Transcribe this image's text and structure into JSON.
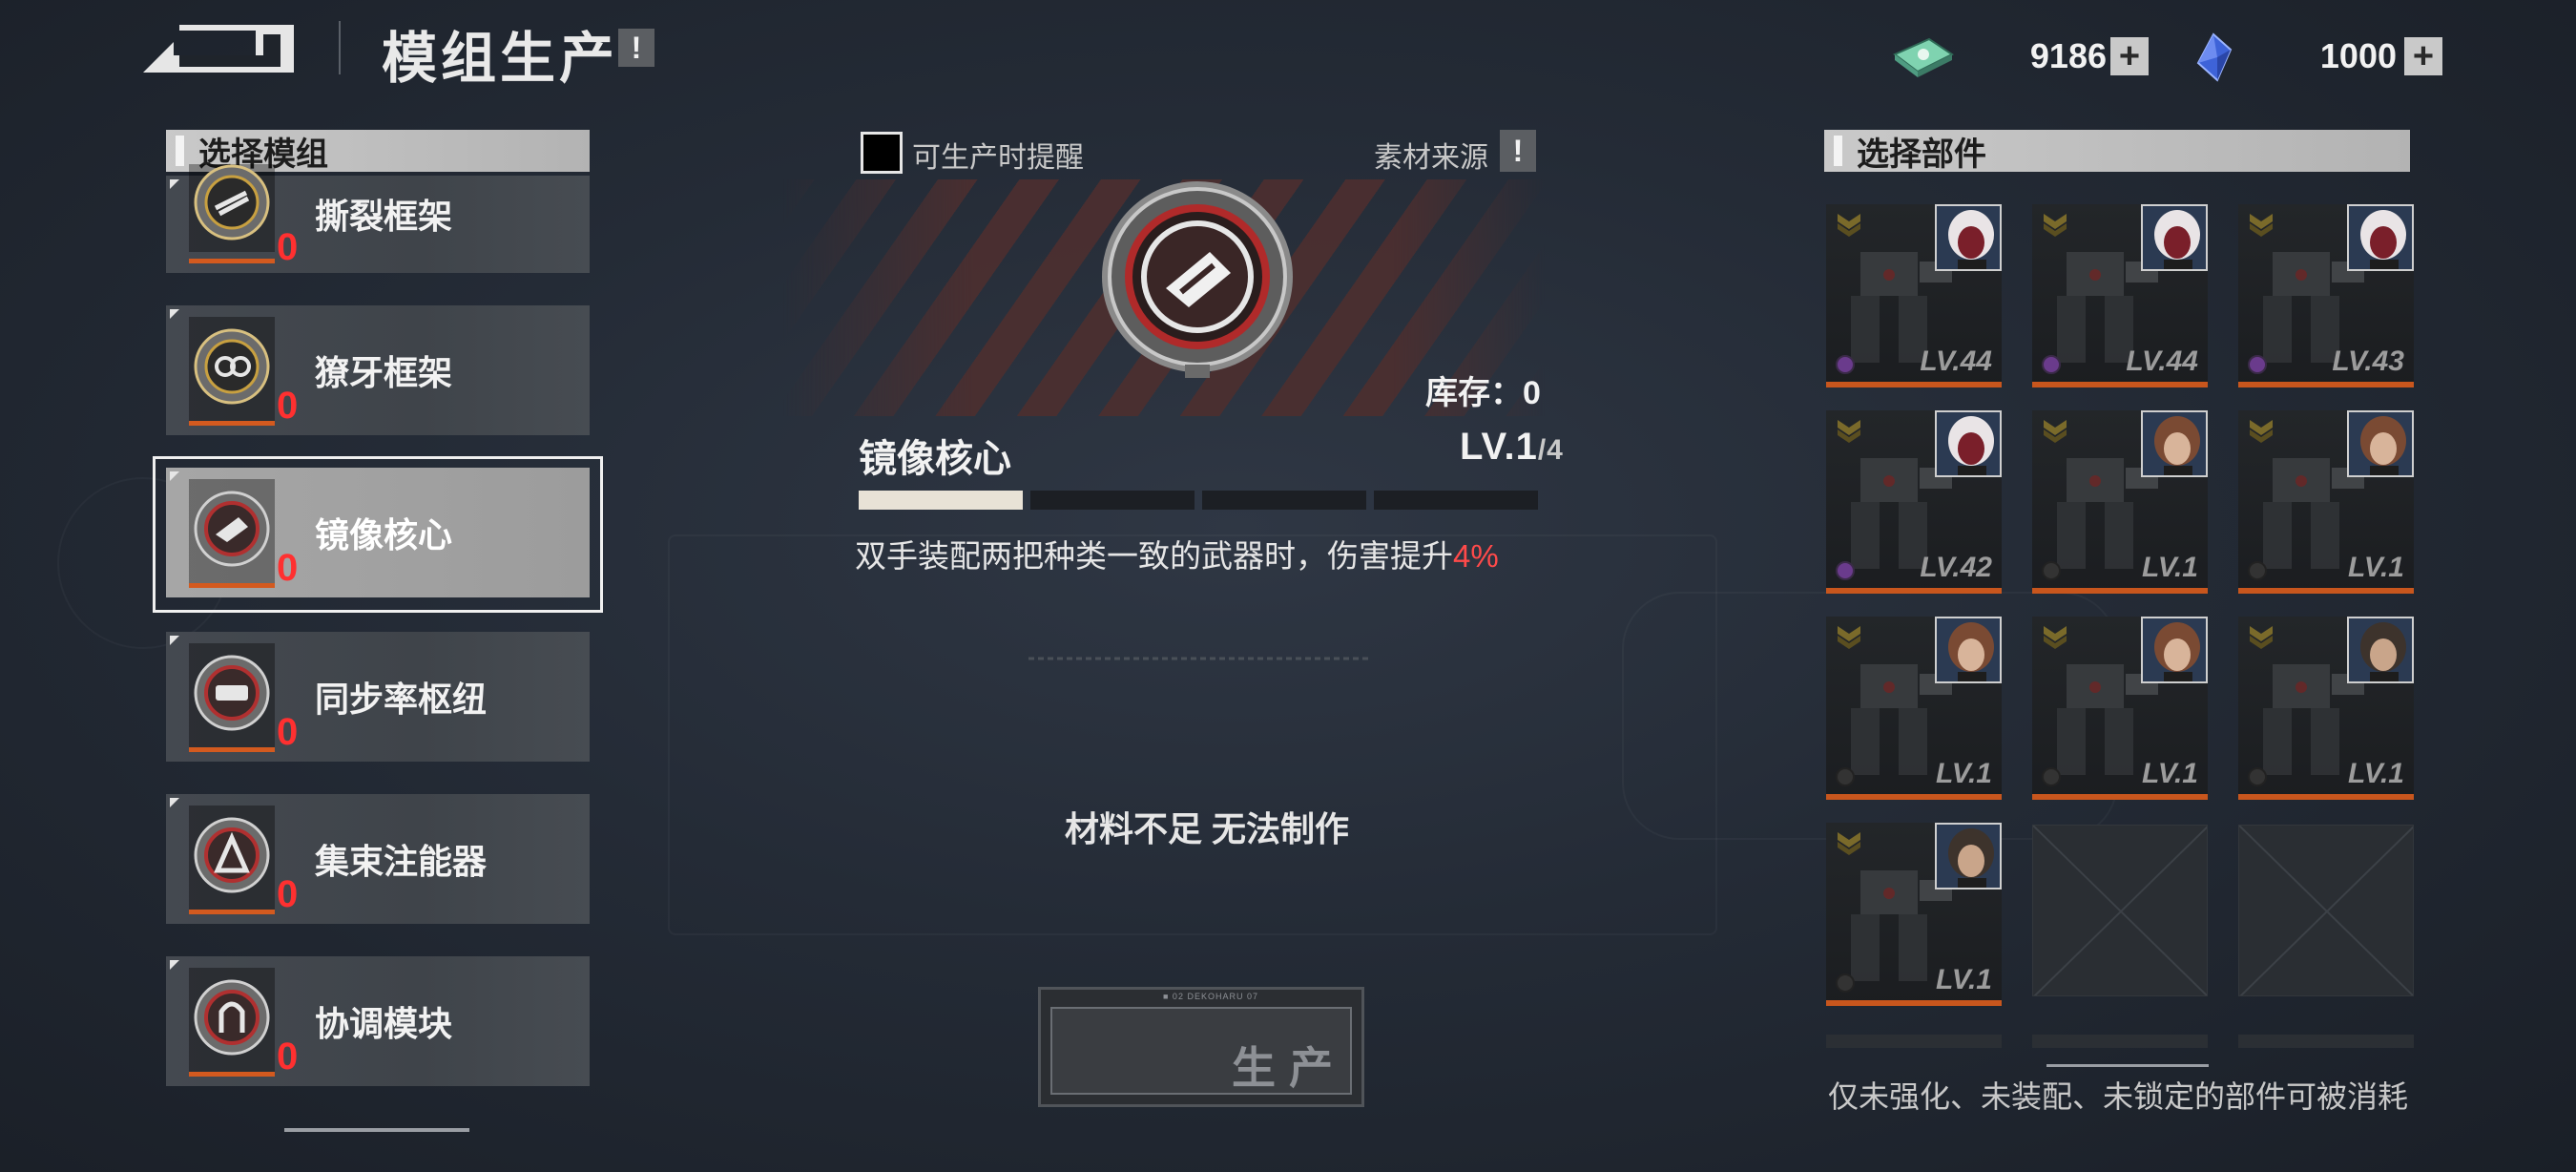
{
  "header": {
    "title": "模组生产",
    "help": "!"
  },
  "currency": [
    {
      "icon": "cash-bundle-icon",
      "value": "9186",
      "plus": "+"
    },
    {
      "icon": "blue-crystal-icon",
      "value": "1000",
      "plus": "+"
    }
  ],
  "left_panel": {
    "header": "选择模组",
    "items": [
      {
        "name": "撕裂框架",
        "count": "0",
        "selected": false
      },
      {
        "name": "獠牙框架",
        "count": "0",
        "selected": false
      },
      {
        "name": "镜像核心",
        "count": "0",
        "selected": true
      },
      {
        "name": "同步率枢纽",
        "count": "0",
        "selected": false
      },
      {
        "name": "集束注能器",
        "count": "0",
        "selected": false
      },
      {
        "name": "协调模块",
        "count": "0",
        "selected": false
      }
    ]
  },
  "center": {
    "remind_label": "可生产时提醒",
    "remind_checked": false,
    "source_label": "素材来源",
    "source_help": "!",
    "stock": "库存：0",
    "module_name": "镜像核心",
    "level": "LV.1",
    "level_max": "/4",
    "level_progress": 0.25,
    "description": "双手装配两把种类一致的武器时，伤害提升",
    "description_value": "4%",
    "status": "材料不足 无法制作",
    "produce_label": "生产",
    "produce_code": "■ 02 DEKOHARU 07"
  },
  "right_panel": {
    "header": "选择部件",
    "parts": [
      {
        "level": "LV.44",
        "pilot": "white-hair",
        "gem": "purple"
      },
      {
        "level": "LV.44",
        "pilot": "white-hair",
        "gem": "purple"
      },
      {
        "level": "LV.43",
        "pilot": "white-hair",
        "gem": "purple"
      },
      {
        "level": "LV.42",
        "pilot": "white-hair",
        "gem": "purple"
      },
      {
        "level": "LV.1",
        "pilot": "brown-hair",
        "gem": "dark"
      },
      {
        "level": "LV.1",
        "pilot": "brown-hair",
        "gem": "dark"
      },
      {
        "level": "LV.1",
        "pilot": "brown-hair",
        "gem": "dark"
      },
      {
        "level": "LV.1",
        "pilot": "brown-hair",
        "gem": "dark"
      },
      {
        "level": "LV.1",
        "pilot": "bearded-man",
        "gem": "dark"
      },
      {
        "level": "LV.1",
        "pilot": "bearded-man",
        "gem": "dark"
      }
    ],
    "note": "仅未强化、未装配、未锁定的部件可被消耗"
  },
  "colors": {
    "accent_orange": "#d35a1f",
    "count_red": "#ff3030",
    "highlight_red": "#ff4a4a",
    "purple_gem": "#6a3b8c"
  }
}
